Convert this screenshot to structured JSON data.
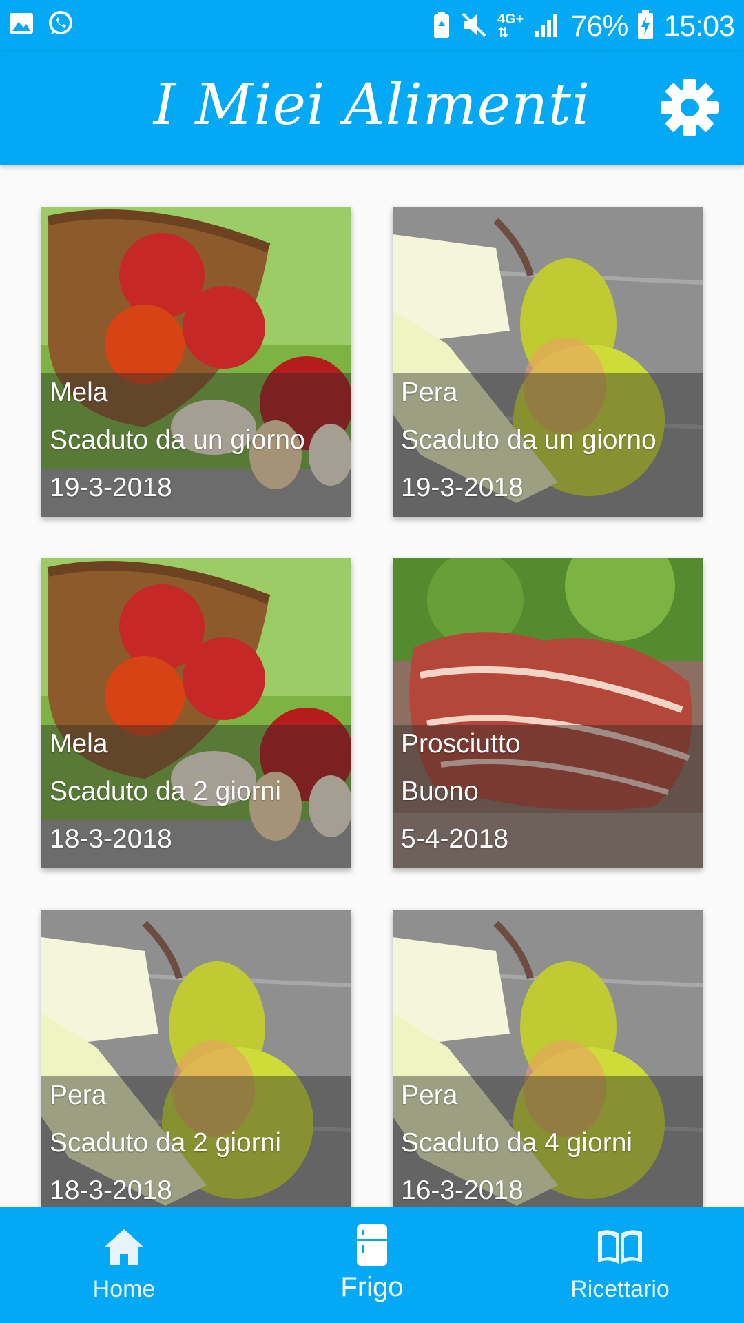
{
  "status_bar": {
    "left_icons": [
      "gallery-icon",
      "whatsapp-icon"
    ],
    "right_icons": [
      "battery-saver-icon",
      "mute-icon",
      "network-4g-icon",
      "signal-icon",
      "battery-charging-icon"
    ],
    "network": "4G+",
    "battery": "76%",
    "time": "15:03"
  },
  "app_bar": {
    "title": "I Miei Alimenti",
    "settings_icon": "gear-icon"
  },
  "foods": [
    {
      "name": "Mela",
      "status": "Scaduto da un giorno",
      "date": "19-3-2018",
      "image": "apple-basket"
    },
    {
      "name": "Pera",
      "status": "Scaduto da un giorno",
      "date": "19-3-2018",
      "image": "pear"
    },
    {
      "name": "Mela",
      "status": "Scaduto da 2 giorni",
      "date": "18-3-2018",
      "image": "apple-basket"
    },
    {
      "name": "Prosciutto",
      "status": "Buono",
      "date": "5-4-2018",
      "image": "prosciutto"
    },
    {
      "name": "Pera",
      "status": "Scaduto da 2 giorni",
      "date": "18-3-2018",
      "image": "pear"
    },
    {
      "name": "Pera",
      "status": "Scaduto da 4 giorni",
      "date": "16-3-2018",
      "image": "pear"
    }
  ],
  "bottom_nav": {
    "items": [
      {
        "label": "Home",
        "icon": "home-icon",
        "active": false
      },
      {
        "label": "Frigo",
        "icon": "fridge-icon",
        "active": true
      },
      {
        "label": "Ricettario",
        "icon": "book-icon",
        "active": false
      }
    ]
  },
  "colors": {
    "primary": "#03a9f4",
    "background": "#fafafa",
    "text_on_primary": "#ffffff"
  }
}
